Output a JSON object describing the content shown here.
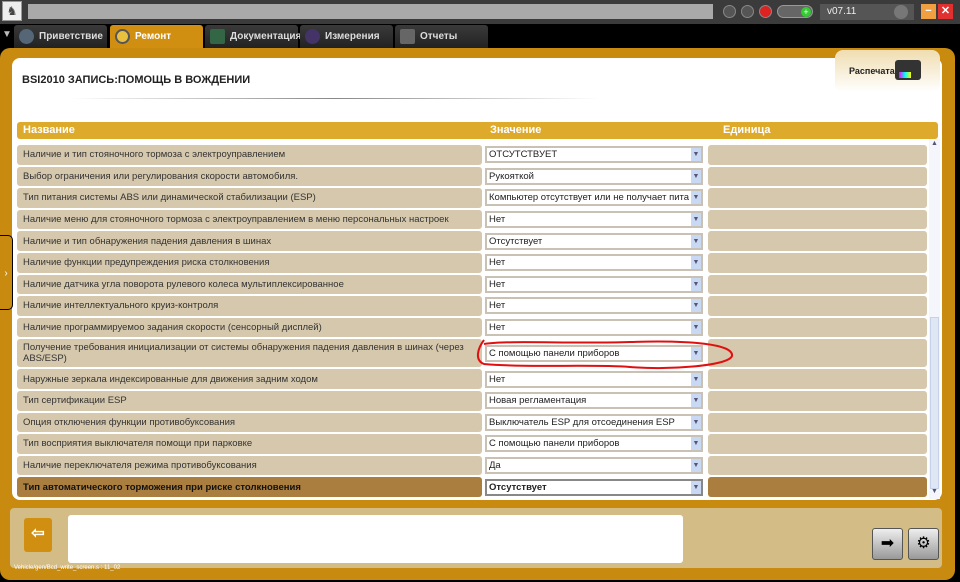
{
  "window": {
    "version": "v07.11"
  },
  "tabs": [
    {
      "label": "Приветствие",
      "icon": "globe-icon",
      "active": false
    },
    {
      "label": "Ремонт",
      "icon": "magnifier-icon",
      "active": true
    },
    {
      "label": "Документация",
      "icon": "book-icon",
      "active": false
    },
    {
      "label": "Измерения",
      "icon": "waveform-icon",
      "active": false
    },
    {
      "label": "Отчеты",
      "icon": "report-icon",
      "active": false
    }
  ],
  "page": {
    "title": "BSI2010  ЗАПИСЬ:ПОМОЩЬ В ВОЖДЕНИИ",
    "print_label": "Распечатать"
  },
  "table": {
    "headers": {
      "name": "Название",
      "value": "Значение",
      "unit": "Единица"
    },
    "rows": [
      {
        "name": "Наличие и тип стояночного тормоза с электроуправлением",
        "value": "ОТСУТСТВУЕТ",
        "unit": ""
      },
      {
        "name": "Выбор ограничения или регулирования скорости автомобиля.",
        "value": "Рукояткой",
        "unit": ""
      },
      {
        "name": "Тип питания системы ABS или динамической стабилизации (ESP)",
        "value": "Компьютер отсутствует или не получает пита",
        "unit": ""
      },
      {
        "name": "Наличие меню для стояночного тормоза с электроуправлением в меню персональных настроек",
        "value": "Нет",
        "unit": ""
      },
      {
        "name": "Наличие и тип обнаружения падения давления в шинах",
        "value": "Отсутствует",
        "unit": ""
      },
      {
        "name": "Наличие функции предупреждения риска столкновения",
        "value": "Нет",
        "unit": ""
      },
      {
        "name": "Наличие датчика угла поворота рулевого колеса мультиплексированное",
        "value": "Нет",
        "unit": ""
      },
      {
        "name": "Наличие интеллектуального круиз-контроля",
        "value": "Нет",
        "unit": ""
      },
      {
        "name": "Наличие программируемоо задания скорости (сенсорный дисплей)",
        "value": "Нет",
        "unit": ""
      },
      {
        "name": "Получение требования инициализации от системы обнаружения падения давления в шинах (через ABS/ESP)",
        "value": "С помощью панели приборов",
        "unit": ""
      },
      {
        "name": "Наружные зеркала индексированные для движения задним ходом",
        "value": "Нет",
        "unit": ""
      },
      {
        "name": "Тип сертификации ESP",
        "value": "Новая регламентация",
        "unit": ""
      },
      {
        "name": "Опция отключения функции противобуксования",
        "value": "Выключатель ESP для отсоединения ESP",
        "unit": ""
      },
      {
        "name": "Тип восприятия выключателя помощи при парковке",
        "value": "С помощью панели приборов",
        "unit": ""
      },
      {
        "name": "Наличие переключателя режима противобуксования",
        "value": "Да",
        "unit": ""
      },
      {
        "name": "Тип автоматического торможения при риске столкновения",
        "value": "Отсутствует",
        "unit": ""
      }
    ]
  },
  "status_bar": {
    "text": "Vehicle/gen/Bcd_write_screen.s : 11_02"
  },
  "colors": {
    "accent": "#c98a10",
    "header": "#deaa2b",
    "row": "#d6c8ad",
    "selected_row": "#a97e3e",
    "annotation": "#e01010"
  }
}
